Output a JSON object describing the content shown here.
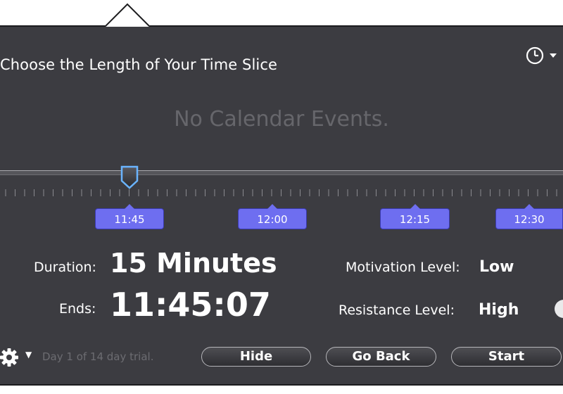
{
  "header": {
    "title": "Choose the Length of Your Time Slice",
    "clock_menu_icon": "clock-icon",
    "caret_icon": "chevron-down-icon"
  },
  "calendar": {
    "empty_message": "No Calendar Events."
  },
  "timeline": {
    "marks": [
      "11:45",
      "12:00",
      "12:15",
      "12:30"
    ],
    "selected": "11:45",
    "accent_color": "#6e6ef0"
  },
  "summary": {
    "duration_label": "Duration:",
    "duration_value": "15 Minutes",
    "ends_label": "Ends:",
    "ends_value": "11:45:07",
    "motivation_label": "Motivation Level:",
    "motivation_value": "Low",
    "resistance_label": "Resistance Level:",
    "resistance_value": "High"
  },
  "footer": {
    "settings_icon": "gear-icon",
    "trial_text": "Day 1 of 14 day trial.",
    "hide_label": "Hide",
    "go_back_label": "Go Back",
    "start_label": "Start"
  }
}
